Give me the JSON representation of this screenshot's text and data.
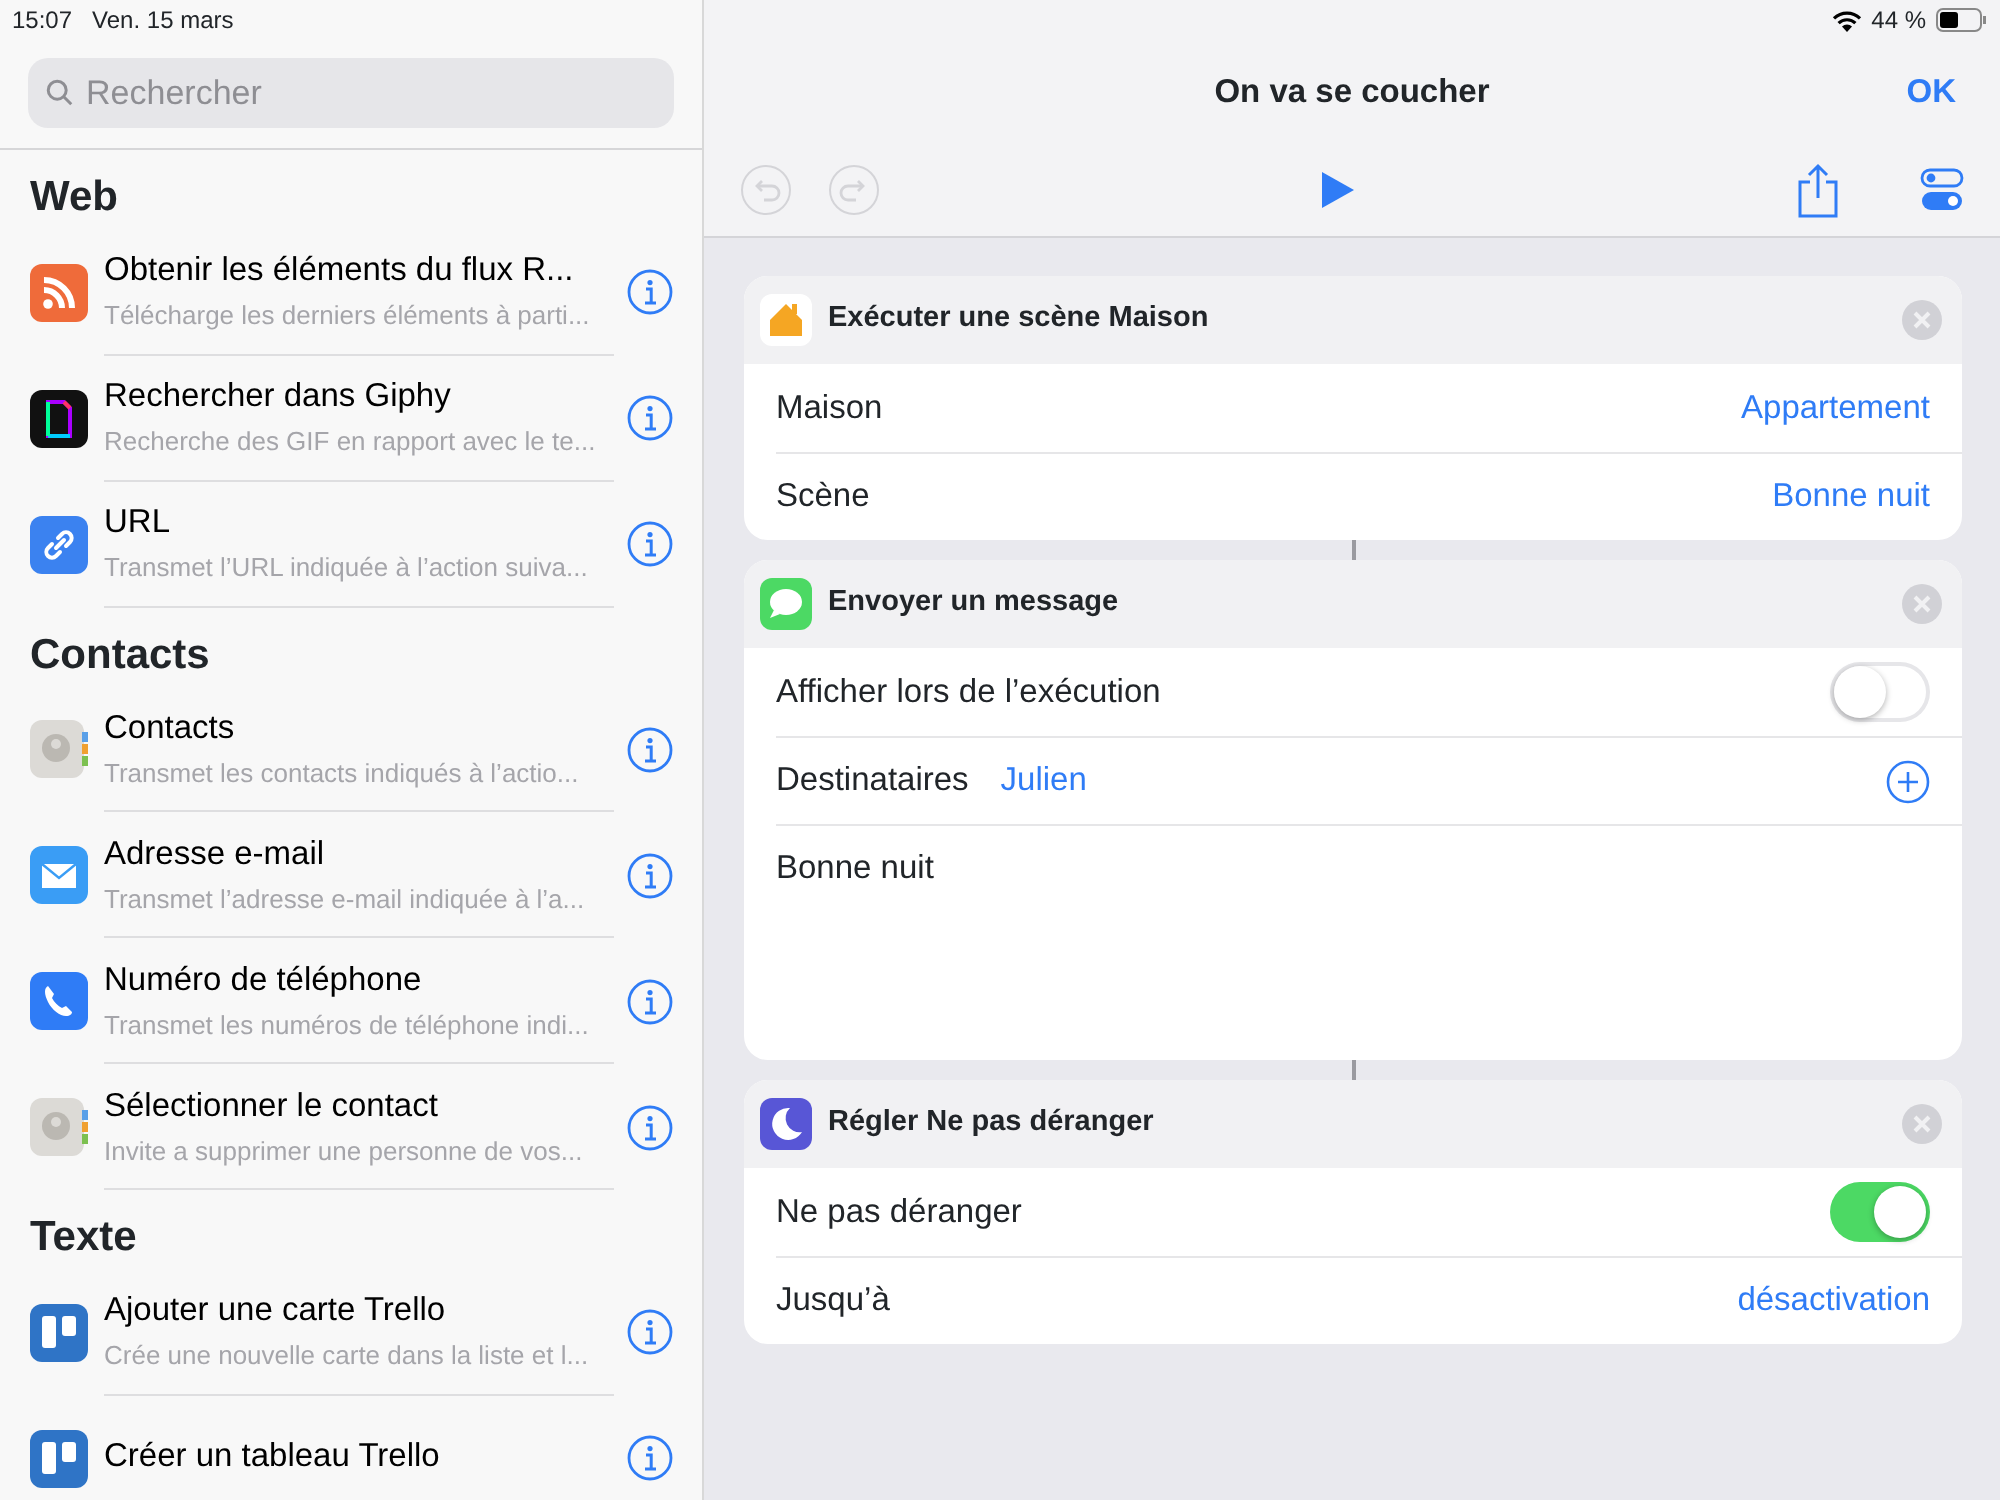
{
  "status_bar": {
    "time": "15:07",
    "date": "Ven. 15 mars",
    "battery": "44 %"
  },
  "search": {
    "placeholder": "Rechercher"
  },
  "sections": [
    {
      "title": "Web",
      "items": [
        {
          "kind": "rss",
          "title": "Obtenir les éléments du flux R...",
          "subtitle": "Télécharge les derniers éléments à parti..."
        },
        {
          "kind": "giphy",
          "title": "Rechercher dans Giphy",
          "subtitle": "Recherche des GIF en rapport avec le te..."
        },
        {
          "kind": "link",
          "title": "URL",
          "subtitle": "Transmet l’URL indiquée à l’action suiva..."
        }
      ]
    },
    {
      "title": "Contacts",
      "items": [
        {
          "kind": "contacts",
          "title": "Contacts",
          "subtitle": "Transmet les contacts indiqués à l’actio..."
        },
        {
          "kind": "mail",
          "title": "Adresse e-mail",
          "subtitle": "Transmet l’adresse e-mail indiquée à l’a..."
        },
        {
          "kind": "phone",
          "title": "Numéro de téléphone",
          "subtitle": "Transmet les numéros de téléphone indi..."
        },
        {
          "kind": "contacts",
          "title": "Sélectionner le contact",
          "subtitle": "Invite a supprimer une personne de vos..."
        }
      ]
    },
    {
      "title": "Texte",
      "items": [
        {
          "kind": "trello",
          "title": "Ajouter une carte Trello",
          "subtitle": "Crée une nouvelle carte dans la liste et l..."
        },
        {
          "kind": "trello",
          "title": "Créer un tableau Trello"
        }
      ]
    }
  ],
  "editor": {
    "title": "On va se coucher",
    "done": "OK",
    "undo_disabled": true,
    "redo_disabled": true
  },
  "actions": [
    {
      "kind": "home",
      "title": "Exécuter une scène Maison",
      "rows": [
        {
          "kind": "value",
          "label": "Maison",
          "value": "Appartement"
        },
        {
          "kind": "value",
          "label": "Scène",
          "value": "Bonne nuit"
        }
      ]
    },
    {
      "kind": "message",
      "title": "Envoyer un message",
      "rows": [
        {
          "kind": "toggle",
          "label": "Afficher lors de l’exécution",
          "on": false
        },
        {
          "kind": "recipients",
          "label": "Destinataires",
          "value": "Julien"
        },
        {
          "kind": "text",
          "label": "Bonne nuit"
        }
      ]
    },
    {
      "kind": "moon",
      "title": "Régler Ne pas déranger",
      "rows": [
        {
          "kind": "toggle",
          "label": "Ne pas déranger",
          "on": true
        },
        {
          "kind": "value",
          "label": "Jusqu’à",
          "value": "désactivation"
        }
      ]
    }
  ]
}
